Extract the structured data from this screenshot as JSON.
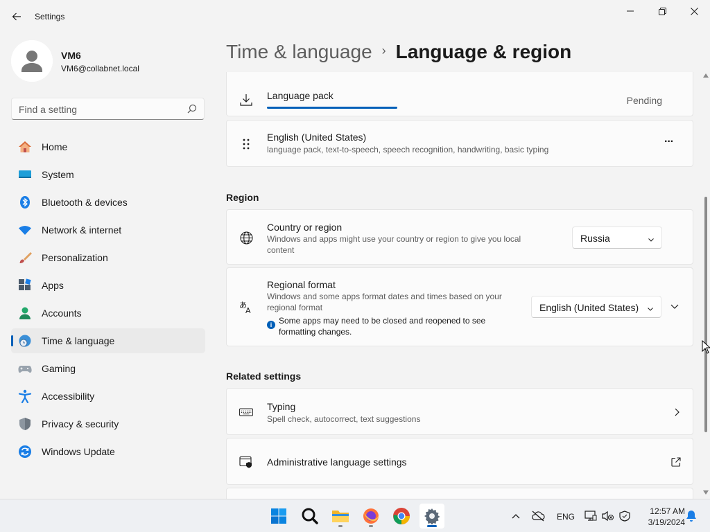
{
  "window": {
    "title": "Settings"
  },
  "profile": {
    "name": "VM6",
    "email": "VM6@collabnet.local"
  },
  "search": {
    "placeholder": "Find a setting"
  },
  "nav": {
    "items": [
      {
        "label": "Home",
        "icon": "home-icon"
      },
      {
        "label": "System",
        "icon": "system-icon"
      },
      {
        "label": "Bluetooth & devices",
        "icon": "bluetooth-icon"
      },
      {
        "label": "Network & internet",
        "icon": "wifi-icon"
      },
      {
        "label": "Personalization",
        "icon": "brush-icon"
      },
      {
        "label": "Apps",
        "icon": "apps-icon"
      },
      {
        "label": "Accounts",
        "icon": "accounts-icon"
      },
      {
        "label": "Time & language",
        "icon": "time-language-icon",
        "active": true
      },
      {
        "label": "Gaming",
        "icon": "gamepad-icon"
      },
      {
        "label": "Accessibility",
        "icon": "accessibility-icon"
      },
      {
        "label": "Privacy & security",
        "icon": "shield-icon"
      },
      {
        "label": "Windows Update",
        "icon": "update-icon"
      }
    ]
  },
  "breadcrumb": {
    "parent": "Time & language",
    "separator": "›",
    "current": "Language & region"
  },
  "language_pack": {
    "title": "Language pack",
    "status": "Pending"
  },
  "language": {
    "title": "English (United States)",
    "features": "language pack, text-to-speech, speech recognition, handwriting, basic typing",
    "more_label": "···"
  },
  "region": {
    "heading": "Region",
    "country": {
      "title": "Country or region",
      "description": "Windows and apps might use your country or region to give you local content",
      "value": "Russia"
    },
    "format": {
      "title": "Regional format",
      "description": "Windows and some apps format dates and times based on your regional format",
      "info": "Some apps may need to be closed and reopened to see formatting changes.",
      "value": "English (United States)"
    }
  },
  "related": {
    "heading": "Related settings",
    "typing": {
      "title": "Typing",
      "description": "Spell check, autocorrect, text suggestions"
    },
    "admin": {
      "title": "Administrative language settings"
    }
  },
  "taskbar": {
    "apps": [
      "windows-start-icon",
      "search-icon",
      "file-explorer-icon",
      "firefox-icon",
      "chrome-icon",
      "settings-icon"
    ],
    "language": "ENG",
    "time": "12:57 AM",
    "date": "3/19/2024"
  },
  "colors": {
    "accent": "#005fb8",
    "background": "#f3f3f3",
    "card": "#fbfbfb"
  }
}
